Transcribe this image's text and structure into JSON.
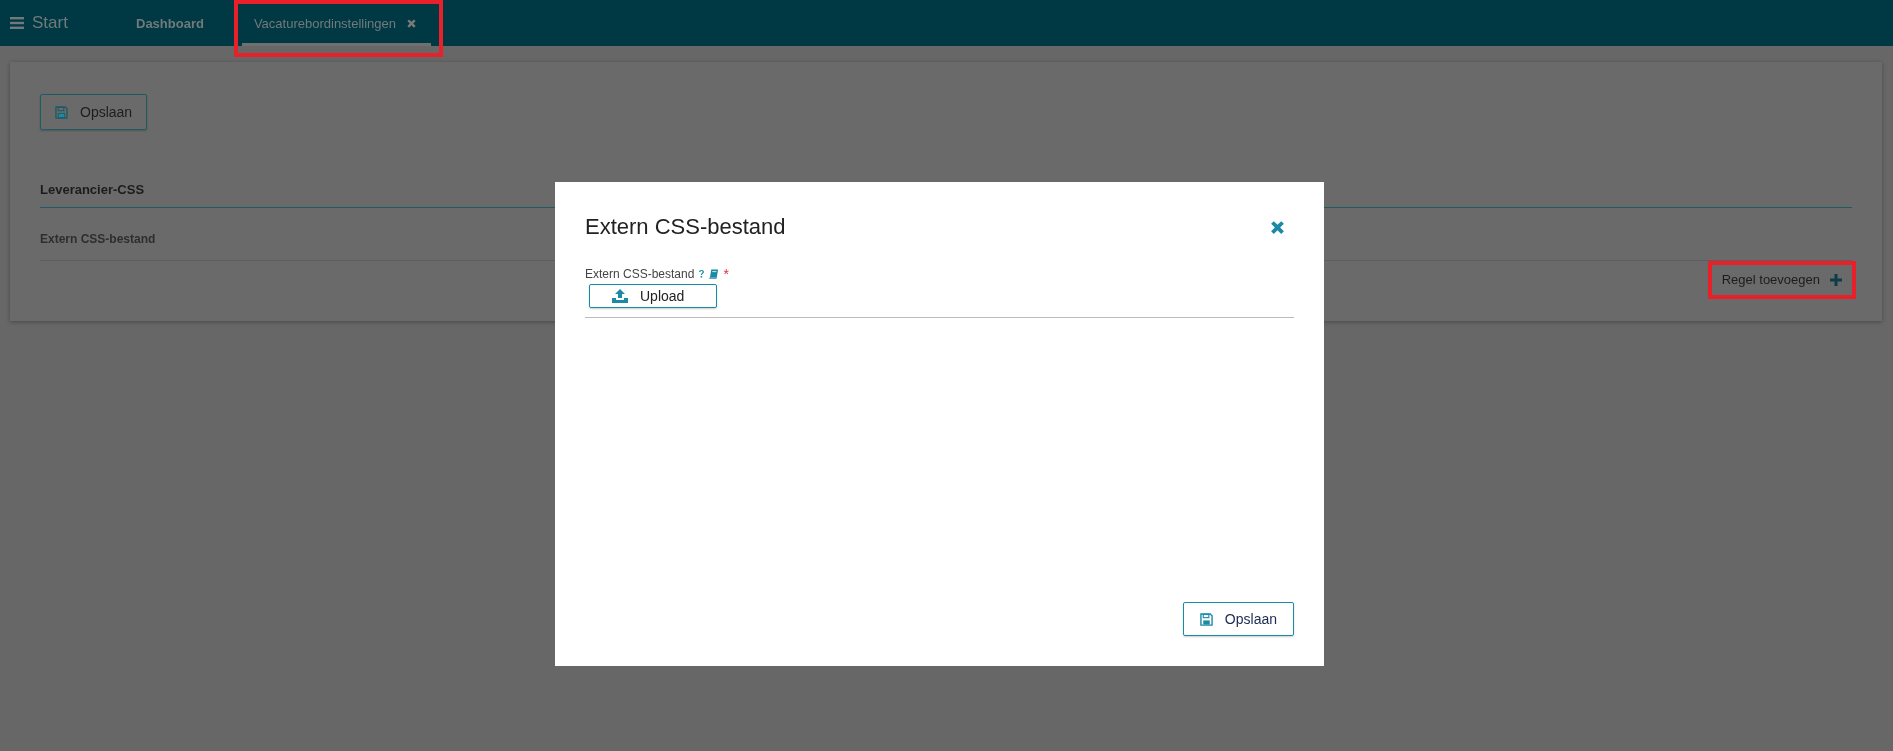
{
  "topbar": {
    "menu_label": "Start",
    "tabs": [
      {
        "label": "Dashboard",
        "selected": false,
        "closable": false,
        "highlighted": false
      },
      {
        "label": "Vacaturebordinstellingen",
        "selected": true,
        "closable": true,
        "highlighted": true
      }
    ]
  },
  "page": {
    "save_button": "Opslaan",
    "section_title": "Leverancier-CSS",
    "rows": [
      {
        "label": "Extern CSS-bestand"
      }
    ],
    "add_row": {
      "label": "Regel toevoegen",
      "highlighted": true
    }
  },
  "modal": {
    "title": "Extern CSS-bestand",
    "field": {
      "label": "Extern CSS-bestand",
      "required": true,
      "required_mark": "*",
      "button": "Upload"
    },
    "save_button": "Opslaan"
  }
}
